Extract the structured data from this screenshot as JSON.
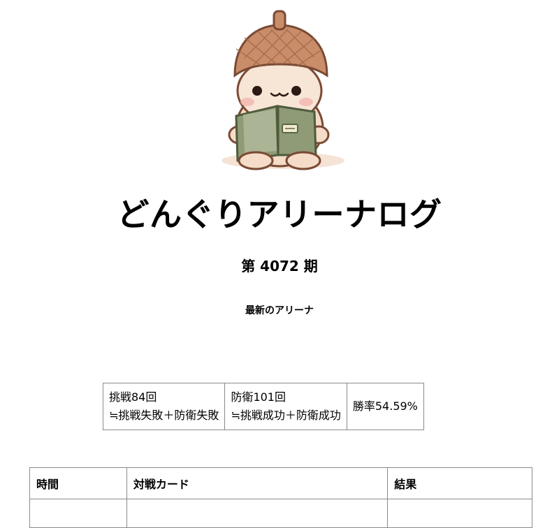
{
  "header": {
    "title": "どんぐりアリーナログ",
    "period": "第 4072 期",
    "arena_link": "最新のアリーナ"
  },
  "mascot": {
    "icon": "acorn-character-reading-book-icon",
    "colors": {
      "cap": "#c98d6a",
      "face": "#f6e1cf",
      "book": "#8f9a76"
    }
  },
  "stats": {
    "challenge_line1": "挑戦84回",
    "challenge_line2": "≒挑戦失敗＋防衛失敗",
    "defense_line1": "防衛101回",
    "defense_line2": "≒挑戦成功＋防衛成功",
    "win_rate": "勝率54.59%"
  },
  "log_table": {
    "columns": [
      "時間",
      "対戦カード",
      "結果"
    ]
  }
}
